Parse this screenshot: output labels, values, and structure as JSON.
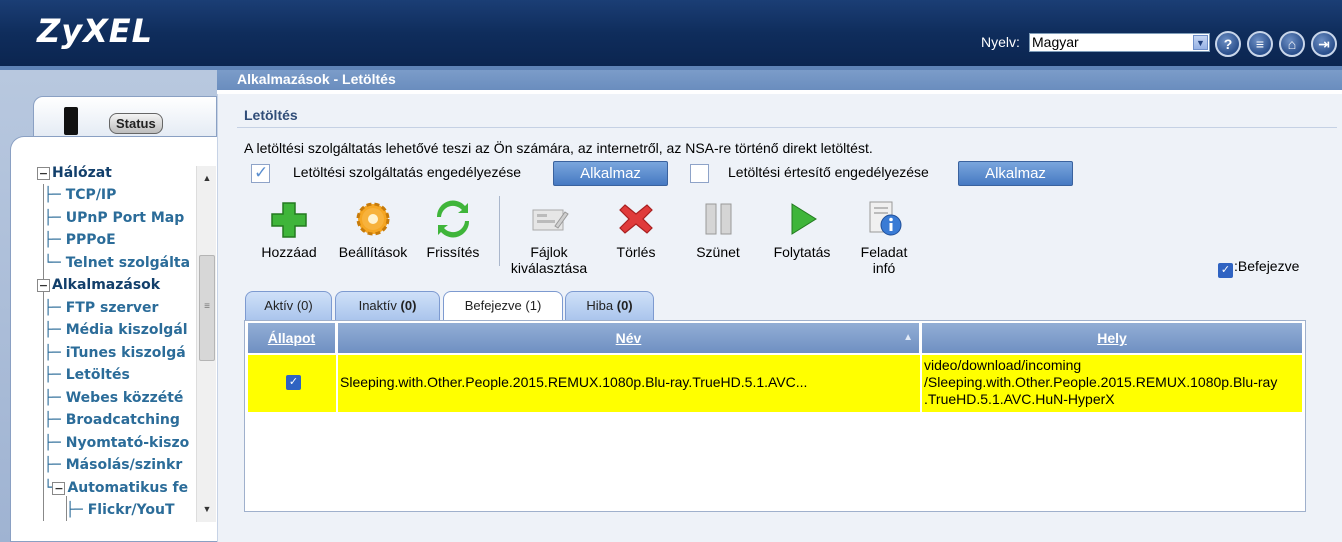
{
  "header": {
    "logo": "ZyXEL",
    "lang_label": "Nyelv:",
    "lang_value": "Magyar",
    "icons": [
      "help-icon",
      "notes-icon",
      "home-icon",
      "logout-icon"
    ]
  },
  "sidebar": {
    "status_label": "Status",
    "tree": {
      "network": "Hálózat",
      "tcpip": "TCP/IP",
      "upnp": "UPnP Port Map",
      "pppoe": "PPPoE",
      "telnet": "Telnet szolgálta",
      "apps": "Alkalmazások",
      "ftp": "FTP szerver",
      "media": "Média kiszolgál",
      "itunes": "iTunes kiszolgá",
      "download": "Letöltés",
      "webpub": "Webes közzété",
      "broadcatching": "Broadcatching",
      "printer": "Nyomtató-kiszo",
      "copy": "Másolás/szinkr",
      "autoupload": "Automatikus fe",
      "flickr": "Flickr/YouT"
    }
  },
  "main": {
    "titlebar": "Alkalmazások - Letöltés",
    "section_title": "Letöltés",
    "description": "A letöltési szolgáltatás lehetővé teszi az Ön számára, az internetről, az NSA-re történő direkt letöltést.",
    "enable_service_label": "Letöltési szolgáltatás engedélyezése",
    "enable_notify_label": "Letöltési értesítő engedélyezése",
    "apply_label": "Alkalmaz",
    "toolbar": {
      "add": "Hozzáad",
      "settings": "Beállítások",
      "refresh": "Frissítés",
      "select_files_1": "Fájlok",
      "select_files_2": "kiválasztása",
      "delete": "Törlés",
      "pause": "Szünet",
      "resume": "Folytatás",
      "task_info_1": "Feladat",
      "task_info_2": "infó"
    },
    "finished_filter": ":Befejezve",
    "tabs": [
      {
        "label": "Aktív",
        "count": "(0)"
      },
      {
        "label": "Inaktív",
        "count": "(0)"
      },
      {
        "label": "Befejezve",
        "count": "(1)"
      },
      {
        "label": "Hiba",
        "count": "(0)"
      }
    ],
    "table": {
      "headers": [
        "Állapot",
        "Név",
        "Hely"
      ],
      "rows": [
        {
          "name": "Sleeping.with.Other.People.2015.REMUX.1080p.Blu-ray.TrueHD.5.1.AVC...",
          "location_1": "video/download/incoming",
          "location_2": "/Sleeping.with.Other.People.2015.REMUX.1080p.Blu-ray",
          "location_3": ".TrueHD.5.1.AVC.HuN-HyperX"
        }
      ]
    }
  }
}
